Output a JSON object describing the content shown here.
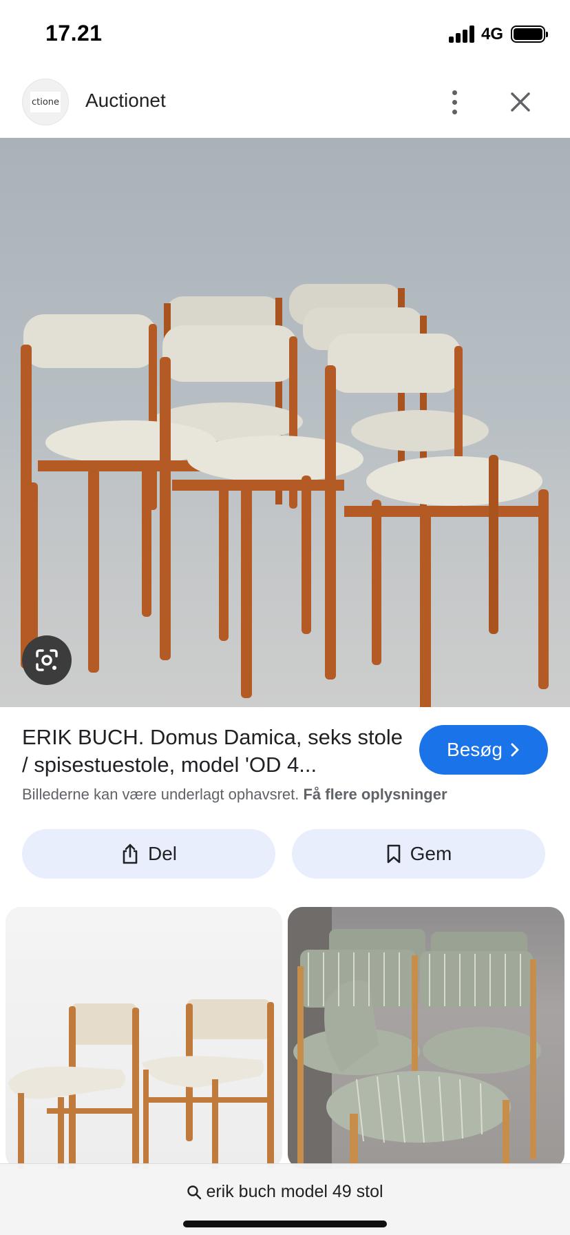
{
  "status": {
    "time": "17.21",
    "network": "4G"
  },
  "source": {
    "name": "Auctionet",
    "logo_text": "ctione"
  },
  "result": {
    "title": "ERIK BUCH. Domus Damica, seks stole / spisestuestole, model 'OD 4...",
    "visit_label": "Besøg",
    "copyright_text": "Billederne kan være underlagt ophavsret.",
    "more_info_link": "Få flere oplysninger"
  },
  "actions": {
    "share_label": "Del",
    "save_label": "Gem"
  },
  "search": {
    "query": "erik buch model 49 stol"
  },
  "icons": {
    "status": [
      "signal-icon",
      "battery-icon"
    ],
    "header": [
      "more-options-icon",
      "close-icon"
    ],
    "image": [
      "google-lens-icon"
    ],
    "buttons": [
      "chevron-right-icon",
      "share-icon",
      "bookmark-icon",
      "search-icon"
    ]
  },
  "colors": {
    "accent": "#1a73e8",
    "action_button_bg": "#e8eefc",
    "secondary_text": "#5f6368",
    "teak": "#b45a24",
    "upholstery": "#e3e0d6"
  }
}
